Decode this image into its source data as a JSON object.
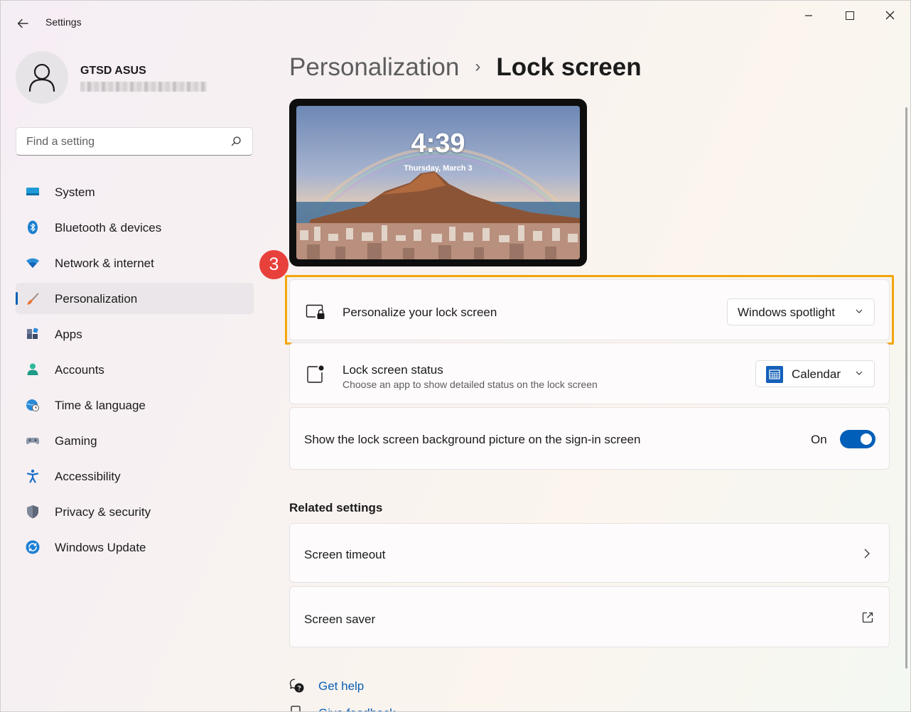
{
  "window": {
    "app_title": "Settings",
    "back_icon": "arrow-left-icon",
    "minimize_glyph": "—",
    "close_glyph": "✕"
  },
  "profile": {
    "name": "GTSD ASUS"
  },
  "search": {
    "placeholder": "Find a setting"
  },
  "nav": {
    "items": [
      {
        "label": "System",
        "icon": "monitor-icon"
      },
      {
        "label": "Bluetooth & devices",
        "icon": "bluetooth-icon"
      },
      {
        "label": "Network & internet",
        "icon": "wifi-icon"
      },
      {
        "label": "Personalization",
        "icon": "paintbrush-icon",
        "active": true
      },
      {
        "label": "Apps",
        "icon": "apps-grid-icon"
      },
      {
        "label": "Accounts",
        "icon": "person-icon"
      },
      {
        "label": "Time & language",
        "icon": "globe-clock-icon"
      },
      {
        "label": "Gaming",
        "icon": "gamepad-icon"
      },
      {
        "label": "Accessibility",
        "icon": "accessibility-icon"
      },
      {
        "label": "Privacy & security",
        "icon": "shield-icon"
      },
      {
        "label": "Windows Update",
        "icon": "update-icon"
      }
    ]
  },
  "breadcrumb": {
    "parent": "Personalization",
    "separator": "›",
    "current": "Lock screen"
  },
  "preview": {
    "time": "4:39",
    "date": "Thursday, March 3"
  },
  "annotation": {
    "step": "3",
    "color": "#f2a50d"
  },
  "settings": {
    "personalize": {
      "title": "Personalize your lock screen",
      "value": "Windows spotlight"
    },
    "status": {
      "title": "Lock screen status",
      "subtitle": "Choose an app to show detailed status on the lock screen",
      "value": "Calendar"
    },
    "signin_bg": {
      "title": "Show the lock screen background picture on the sign-in screen",
      "state": "On"
    }
  },
  "related": {
    "heading": "Related settings",
    "items": [
      {
        "label": "Screen timeout",
        "icon": "chevron-right-icon"
      },
      {
        "label": "Screen saver",
        "icon": "external-link-icon"
      }
    ]
  },
  "links": {
    "get_help": "Get help",
    "give_feedback": "Give feedback"
  },
  "colors": {
    "accent": "#005fb8",
    "badge": "#e8403b"
  }
}
